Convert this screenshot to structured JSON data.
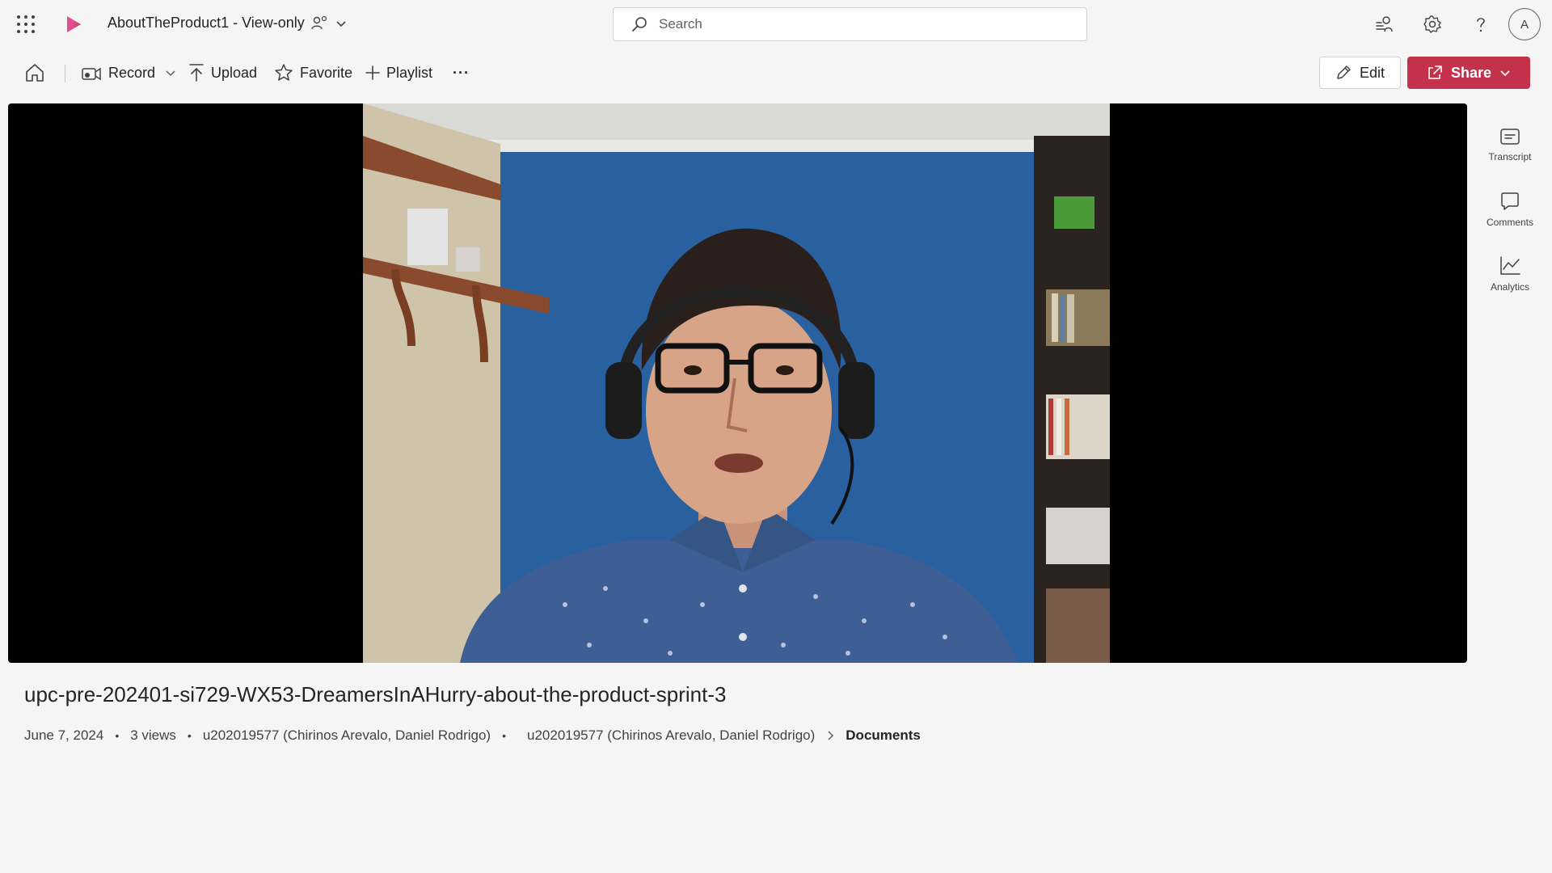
{
  "header": {
    "doc_title": "AboutTheProduct1 - View-only",
    "search_placeholder": "Search",
    "avatar_initial": "A",
    "icons": [
      "waffle-icon",
      "stream-logo-icon",
      "sensitivity-icon",
      "chevron-down-icon",
      "search-icon",
      "people-connect-icon",
      "settings-icon",
      "help-icon"
    ]
  },
  "toolbar": {
    "record_label": "Record",
    "upload_label": "Upload",
    "favorite_label": "Favorite",
    "playlist_label": "Playlist",
    "more_label": "···",
    "edit_label": "Edit",
    "share_label": "Share"
  },
  "side_panel": {
    "transcript_label": "Transcript",
    "comments_label": "Comments",
    "analytics_label": "Analytics"
  },
  "video": {
    "title": "upc-pre-202401-si729-WX53-DreamersInAHurry-about-the-product-sprint-3",
    "date": "June 7, 2024",
    "views": "3 views",
    "owner": "u202019577 (Chirinos Arevalo, Daniel Rodrigo)",
    "location_owner": "u202019577 (Chirinos Arevalo, Daniel Rodrigo)",
    "location_folder": "Documents"
  },
  "colors": {
    "brand_accent": "#c4314b",
    "background": "#f5f5f5",
    "player_bg": "#000000"
  }
}
